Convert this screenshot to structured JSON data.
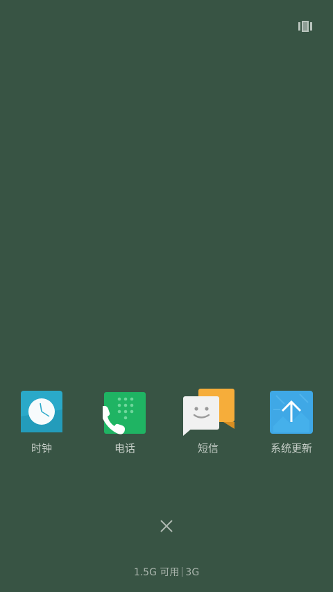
{
  "apps": [
    {
      "label": "时钟",
      "icon": "clock-icon"
    },
    {
      "label": "电话",
      "icon": "phone-icon"
    },
    {
      "label": "短信",
      "icon": "messages-icon"
    },
    {
      "label": "系统更新",
      "icon": "system-update-icon"
    }
  ],
  "memory": {
    "available": "1.5G 可用",
    "total": "3G"
  },
  "colors": {
    "background": "#385444",
    "clock": "#2aa9c9",
    "phone": "#1fb463",
    "messages_back": "#f6ad3a",
    "messages_front": "#f1f1f1",
    "update": "#3fa8e6"
  }
}
